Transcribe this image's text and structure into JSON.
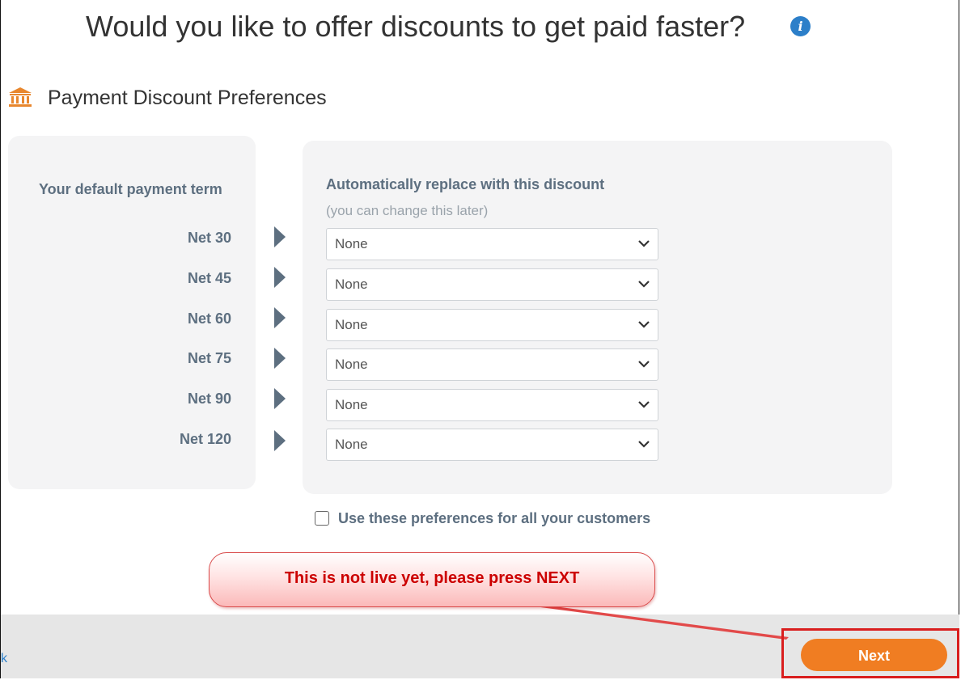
{
  "page": {
    "title": "Would you like to offer discounts to get paid faster?",
    "section_title": "Payment Discount Preferences"
  },
  "left_panel": {
    "header": "Your default payment term",
    "terms": [
      "Net 30",
      "Net 45",
      "Net 60",
      "Net 75",
      "Net 90",
      "Net 120"
    ]
  },
  "right_panel": {
    "header": "Automatically replace with this discount",
    "subheader": "(you can change this later)",
    "selects": [
      "None",
      "None",
      "None",
      "None",
      "None",
      "None"
    ]
  },
  "checkbox": {
    "label": "Use these preferences for all your customers",
    "checked": false
  },
  "callout": {
    "text": "This is not live yet, please press NEXT"
  },
  "footer": {
    "back_label": "k",
    "next_label": "Next"
  },
  "colors": {
    "accent": "#f07d22",
    "info": "#2c7fc9",
    "label": "#5d6f80",
    "highlight": "#d91e1e"
  }
}
